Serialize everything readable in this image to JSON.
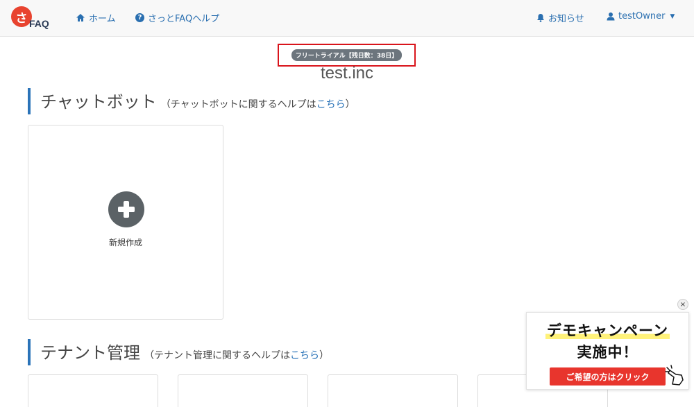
{
  "navbar": {
    "logo_char": "さ",
    "logo_text": "FAQ",
    "home_label": "ホーム",
    "help_label": "さっとFAQヘルプ",
    "notice_label": "お知らせ",
    "user_label": "testOwner"
  },
  "trial_badge": "フリートライアル【残日数：38日】",
  "company_name": "test.inc",
  "chatbot_section": {
    "title": "チャットボット",
    "sub_prefix": "（チャットボットに関するヘルプは",
    "link": "こちら",
    "sub_suffix": "）",
    "new_label": "新規作成"
  },
  "tenant_section": {
    "title": "テナント管理",
    "sub_prefix": "（テナント管理に関するヘルプは",
    "link": "こちら",
    "sub_suffix": "）"
  },
  "demo_popup": {
    "line1": "デモキャンペーン",
    "line2": "実施中！",
    "button": "ご希望の方はクリック",
    "close": "×"
  },
  "colors": {
    "brand_red": "#e8432f",
    "link_blue": "#2a73b8",
    "badge_gray": "#6c757d",
    "highlight_box": "#d9141b"
  }
}
